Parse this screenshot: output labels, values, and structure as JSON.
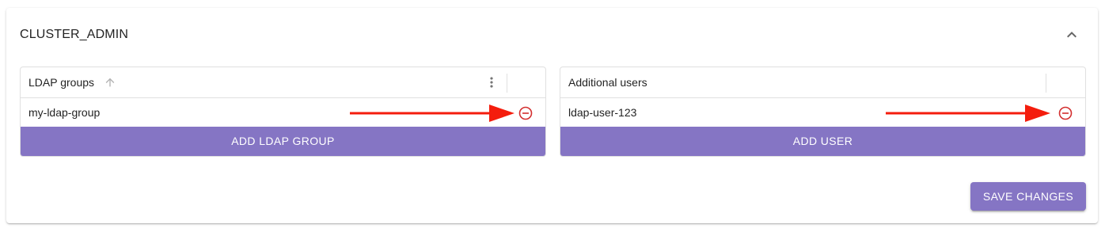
{
  "section": {
    "title": "CLUSTER_ADMIN",
    "collapse_icon": "chevron-up-icon"
  },
  "ldap_groups": {
    "column_title": "LDAP groups",
    "sort_icon": "arrow-up-icon",
    "menu_icon": "more-vert-icon",
    "rows": [
      {
        "value": "my-ldap-group",
        "action_icon": "remove-circle-icon"
      }
    ],
    "add_button_label": "ADD LDAP GROUP"
  },
  "additional_users": {
    "column_title": "Additional users",
    "rows": [
      {
        "value": "ldap-user-123",
        "action_icon": "remove-circle-icon"
      }
    ],
    "add_button_label": "ADD USER"
  },
  "save_button_label": "SAVE CHANGES",
  "colors": {
    "accent": "#8575c4",
    "annotation_arrow": "#f41d0d",
    "remove_icon": "#d32f2f"
  }
}
